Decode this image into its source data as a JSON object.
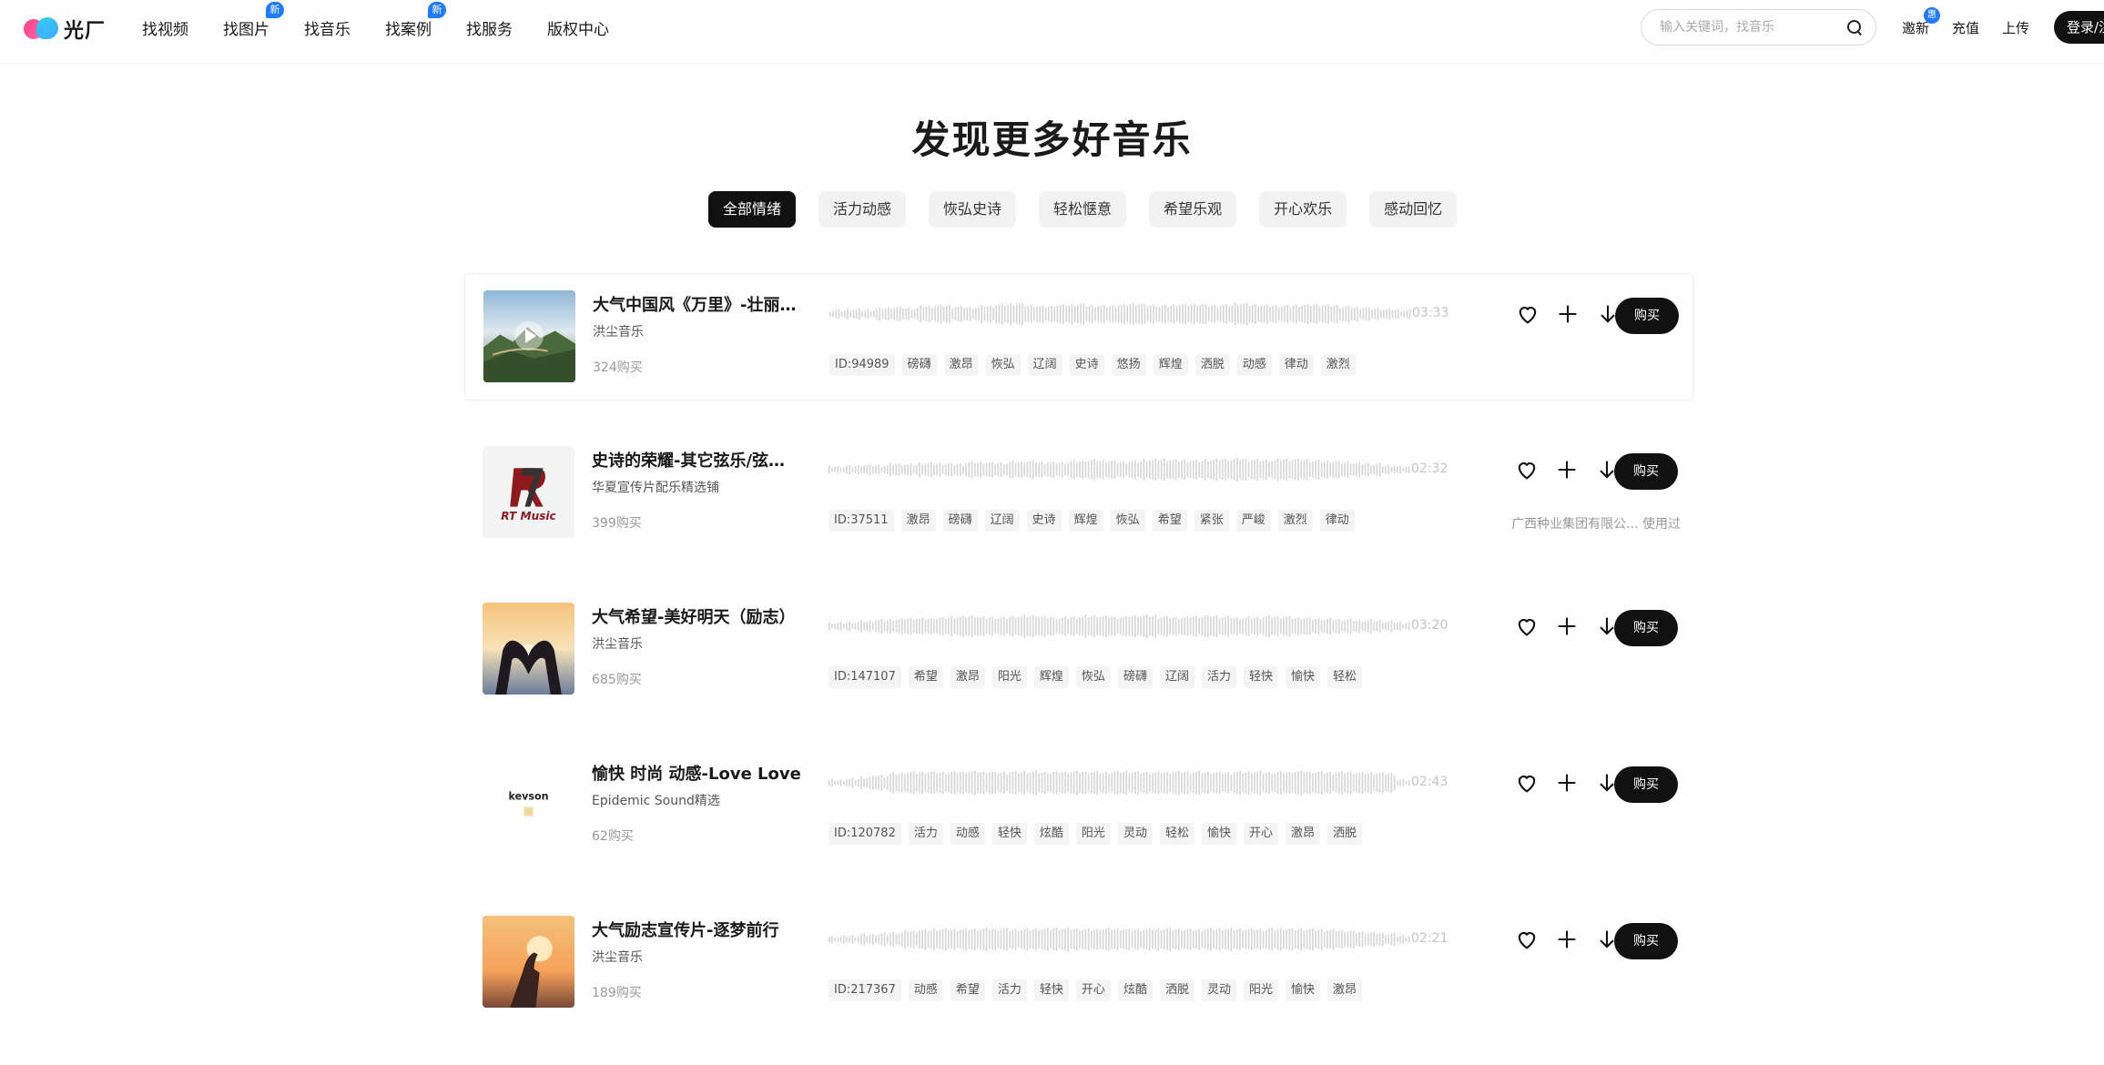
{
  "header": {
    "logo_text": "光厂",
    "nav": [
      {
        "label": "找视频",
        "badge": ""
      },
      {
        "label": "找图片",
        "badge": "新"
      },
      {
        "label": "找音乐",
        "badge": ""
      },
      {
        "label": "找案例",
        "badge": "新"
      },
      {
        "label": "找服务",
        "badge": ""
      },
      {
        "label": "版权中心",
        "badge": ""
      }
    ],
    "search_placeholder": "输入关键词，找音乐",
    "invite_label": "邀新",
    "invite_badge": "惠",
    "recharge_label": "充值",
    "upload_label": "上传",
    "login_label": "登录/注册"
  },
  "page_title": "发现更多好音乐",
  "tabs": [
    "全部情绪",
    "活力动感",
    "恢弘史诗",
    "轻松惬意",
    "希望乐观",
    "开心欢乐",
    "感动回忆"
  ],
  "active_tab": "全部情绪",
  "tracks": [
    {
      "title": "大气中国风《万里》-壮丽山河",
      "artist": "洪尘音乐",
      "buys": "324购买",
      "duration": "03:33",
      "tags": [
        "ID:94989",
        "磅礴",
        "激昂",
        "恢弘",
        "辽阔",
        "史诗",
        "悠扬",
        "辉煌",
        "洒脱",
        "动感",
        "律动",
        "激烈"
      ],
      "used": "",
      "cover": "mountain"
    },
    {
      "title": "史诗的荣耀-其它弦乐/弦乐团",
      "artist": "华夏宣传片配乐精选铺",
      "buys": "399购买",
      "duration": "02:32",
      "tags": [
        "ID:37511",
        "激昂",
        "磅礴",
        "辽阔",
        "史诗",
        "辉煌",
        "恢弘",
        "希望",
        "紧张",
        "严峻",
        "激烈",
        "律动"
      ],
      "used": "广西种业集团有限公... 使用过",
      "cover": "rt-music",
      "cover_text": "RT Music"
    },
    {
      "title": "大气希望-美好明天（励志）",
      "artist": "洪尘音乐",
      "buys": "685购买",
      "duration": "03:20",
      "tags": [
        "ID:147107",
        "希望",
        "激昂",
        "阳光",
        "辉煌",
        "恢弘",
        "磅礴",
        "辽阔",
        "活力",
        "轻快",
        "愉快",
        "轻松"
      ],
      "used": "",
      "cover": "heart-sunset"
    },
    {
      "title": "愉快 时尚 动感-Love Love",
      "artist": "Epidemic Sound精选",
      "buys": "62购买",
      "duration": "02:43",
      "tags": [
        "ID:120782",
        "活力",
        "动感",
        "轻快",
        "炫酷",
        "阳光",
        "灵动",
        "轻松",
        "愉快",
        "开心",
        "激昂",
        "洒脱"
      ],
      "used": "",
      "cover": "kevson",
      "cover_text": "kevson"
    },
    {
      "title": "大气励志宣传片-逐梦前行",
      "artist": "洪尘音乐",
      "buys": "189购买",
      "duration": "02:21",
      "tags": [
        "ID:217367",
        "动感",
        "希望",
        "活力",
        "轻快",
        "开心",
        "炫酷",
        "洒脱",
        "灵动",
        "阳光",
        "愉快",
        "激昂"
      ],
      "used": "",
      "cover": "hand-sunset"
    }
  ],
  "buy_label": "购买",
  "icons": {
    "like": "heart-icon",
    "add": "plus-icon",
    "download": "download-icon"
  }
}
